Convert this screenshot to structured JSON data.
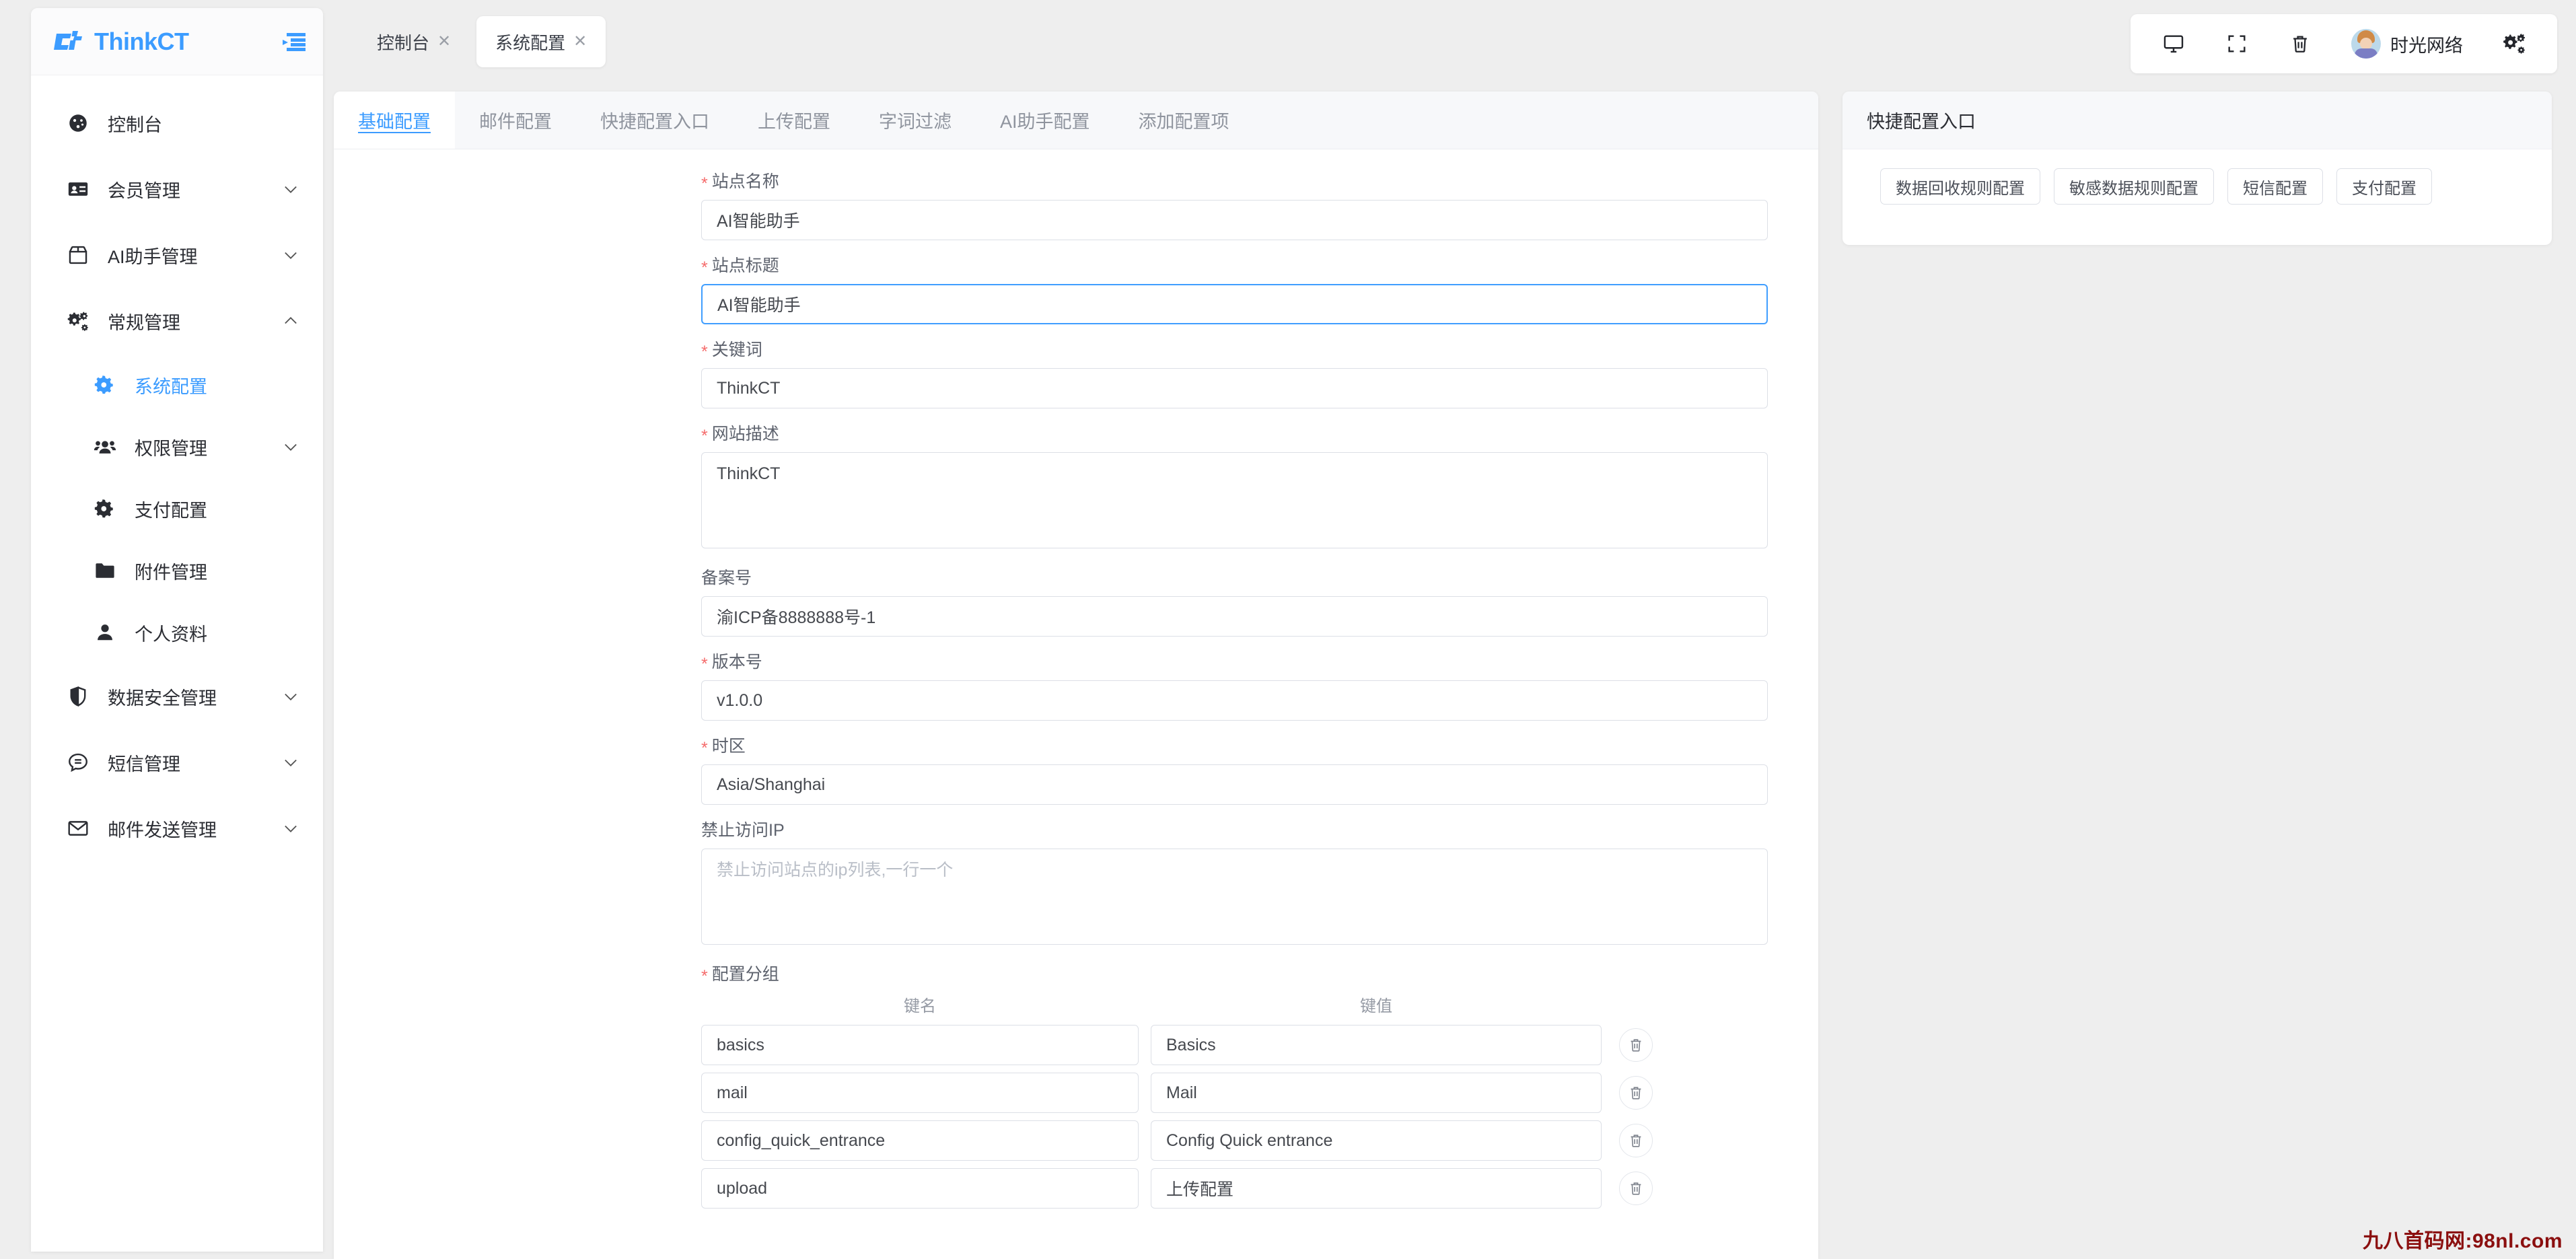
{
  "brand": {
    "name": "ThinkCT",
    "logo_icon": "thinkct-logo",
    "collapse_icon": "sidebar-collapse-icon"
  },
  "sidebar": {
    "items": [
      {
        "label": "控制台",
        "icon": "dashboard-icon",
        "expandable": false,
        "active": false,
        "sub": false
      },
      {
        "label": "会员管理",
        "icon": "id-card-icon",
        "expandable": true,
        "active": false,
        "sub": false,
        "arrow": "chevron-down-icon"
      },
      {
        "label": "AI助手管理",
        "icon": "box-icon",
        "expandable": true,
        "active": false,
        "sub": false,
        "arrow": "chevron-down-icon"
      },
      {
        "label": "常规管理",
        "icon": "gears-icon",
        "expandable": true,
        "active": false,
        "sub": false,
        "arrow": "chevron-up-icon"
      },
      {
        "label": "系统配置",
        "icon": "gear-icon",
        "expandable": false,
        "active": true,
        "sub": true
      },
      {
        "label": "权限管理",
        "icon": "users-icon",
        "expandable": true,
        "active": false,
        "sub": true,
        "arrow": "chevron-down-icon"
      },
      {
        "label": "支付配置",
        "icon": "gear-icon",
        "expandable": false,
        "active": false,
        "sub": true
      },
      {
        "label": "附件管理",
        "icon": "folder-icon",
        "expandable": false,
        "active": false,
        "sub": true
      },
      {
        "label": "个人资料",
        "icon": "user-icon",
        "expandable": false,
        "active": false,
        "sub": true
      },
      {
        "label": "数据安全管理",
        "icon": "shield-icon",
        "expandable": true,
        "active": false,
        "sub": false,
        "arrow": "chevron-down-icon"
      },
      {
        "label": "短信管理",
        "icon": "chat-icon",
        "expandable": true,
        "active": false,
        "sub": false,
        "arrow": "chevron-down-icon"
      },
      {
        "label": "邮件发送管理",
        "icon": "mail-icon",
        "expandable": true,
        "active": false,
        "sub": false,
        "arrow": "chevron-down-icon"
      }
    ]
  },
  "page_tabs": [
    {
      "label": "控制台",
      "active": false,
      "close_icon": "close-icon"
    },
    {
      "label": "系统配置",
      "active": true,
      "close_icon": "close-icon"
    }
  ],
  "toolbar": {
    "icons": [
      {
        "name": "monitor-icon"
      },
      {
        "name": "fullscreen-icon"
      },
      {
        "name": "trash-icon"
      }
    ],
    "user_name": "时光网络",
    "avatar_icon": "avatar",
    "settings_icon": "gears-settings-icon"
  },
  "form_tabs": [
    {
      "label": "基础配置",
      "active": true
    },
    {
      "label": "邮件配置",
      "active": false
    },
    {
      "label": "快捷配置入口",
      "active": false
    },
    {
      "label": "上传配置",
      "active": false
    },
    {
      "label": "字词过滤",
      "active": false
    },
    {
      "label": "AI助手配置",
      "active": false
    },
    {
      "label": "添加配置项",
      "active": false
    }
  ],
  "form": {
    "fields": [
      {
        "label": "站点名称",
        "required": true,
        "type": "input",
        "value": "AI智能助手",
        "placeholder": "",
        "focused": false
      },
      {
        "label": "站点标题",
        "required": true,
        "type": "input",
        "value": "AI智能助手",
        "placeholder": "",
        "focused": true
      },
      {
        "label": "关键词",
        "required": true,
        "type": "input",
        "value": "ThinkCT",
        "placeholder": "",
        "focused": false
      },
      {
        "label": "网站描述",
        "required": true,
        "type": "textarea",
        "value": "ThinkCT",
        "placeholder": "",
        "focused": false
      },
      {
        "label": "备案号",
        "required": false,
        "type": "input",
        "value": "渝ICP备8888888号-1",
        "placeholder": "",
        "focused": false
      },
      {
        "label": "版本号",
        "required": true,
        "type": "input",
        "value": "v1.0.0",
        "placeholder": "",
        "focused": false
      },
      {
        "label": "时区",
        "required": true,
        "type": "input",
        "value": "Asia/Shanghai",
        "placeholder": "",
        "focused": false
      },
      {
        "label": "禁止访问IP",
        "required": false,
        "type": "textarea",
        "value": "",
        "placeholder": "禁止访问站点的ip列表,一行一个",
        "focused": false
      }
    ],
    "config_group": {
      "label": "配置分组",
      "required": true,
      "columns": [
        "键名",
        "键值"
      ],
      "rows": [
        {
          "key": "basics",
          "value": "Basics",
          "delete_icon": "trash-icon"
        },
        {
          "key": "mail",
          "value": "Mail",
          "delete_icon": "trash-icon"
        },
        {
          "key": "config_quick_entrance",
          "value": "Config Quick entrance",
          "delete_icon": "trash-icon"
        },
        {
          "key": "upload",
          "value": "上传配置",
          "delete_icon": "trash-icon"
        }
      ]
    }
  },
  "quick_panel": {
    "title": "快捷配置入口",
    "buttons": [
      {
        "label": "数据回收规则配置"
      },
      {
        "label": "敏感数据规则配置"
      },
      {
        "label": "短信配置"
      },
      {
        "label": "支付配置"
      }
    ]
  },
  "watermark": "九八首码网:98nl.com",
  "colors": {
    "accent": "#3C9CFF",
    "focus_border": "#409EFF",
    "required_star": "#f56c6c",
    "page_bg": "#eeeeee",
    "card_bg": "#ffffff",
    "tabbar_bg": "#f7f8fa",
    "watermark": "#8b0f0f"
  }
}
